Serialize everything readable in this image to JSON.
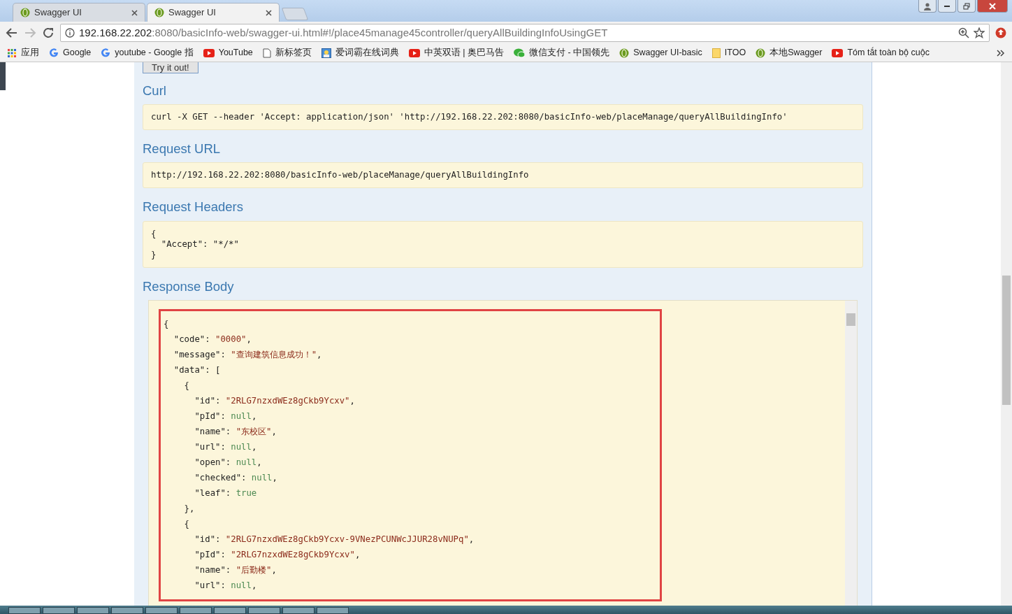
{
  "tabs": [
    {
      "title": "Swagger UI",
      "selected": false
    },
    {
      "title": "Swagger UI",
      "selected": true
    }
  ],
  "address": {
    "host": "192.168.22.202",
    "rest": ":8080/basicInfo-web/swagger-ui.html#!/place45manage45controller/queryAllBuildingInfoUsingGET"
  },
  "bookmarks": [
    {
      "label": "应用",
      "kind": "apps"
    },
    {
      "label": "Google",
      "kind": "google"
    },
    {
      "label": "youtube - Google 指",
      "kind": "google"
    },
    {
      "label": "YouTube",
      "kind": "youtube"
    },
    {
      "label": "新标签页",
      "kind": "page"
    },
    {
      "label": "爱词霸在线词典",
      "kind": "image"
    },
    {
      "label": "中英双语 | 奥巴马告",
      "kind": "youtube"
    },
    {
      "label": "微信支付 - 中国领先",
      "kind": "wechat"
    },
    {
      "label": "Swagger UI-basic",
      "kind": "globe"
    },
    {
      "label": "ITOO",
      "kind": "folder"
    },
    {
      "label": "本地Swagger",
      "kind": "globe"
    },
    {
      "label": "Tóm tắt toàn bộ cuộc",
      "kind": "youtube"
    }
  ],
  "try_button": "Try it out!",
  "sections": [
    {
      "heading": "Curl",
      "lines": [
        "curl -X GET --header 'Accept: application/json' 'http://192.168.22.202:8080/basicInfo-web/placeManage/queryAllBuildingInfo'"
      ]
    },
    {
      "heading": "Request URL",
      "lines": [
        "http://192.168.22.202:8080/basicInfo-web/placeManage/queryAllBuildingInfo"
      ]
    },
    {
      "heading": "Request Headers",
      "lines": [
        "{",
        "  \"Accept\": \"*/*\"",
        "}"
      ]
    }
  ],
  "response": {
    "heading": "Response Body",
    "highlighted": true,
    "lines": [
      [
        {
          "text": "{",
          "kind": "punct"
        }
      ],
      [
        {
          "text": "  \"code\": ",
          "kind": "key"
        },
        {
          "text": "\"0000\"",
          "kind": "string"
        },
        {
          "text": ",",
          "kind": "punct"
        }
      ],
      [
        {
          "text": "  \"message\": ",
          "kind": "key"
        },
        {
          "text": "\"查询建筑信息成功！\"",
          "kind": "string"
        },
        {
          "text": ",",
          "kind": "punct"
        }
      ],
      [
        {
          "text": "  \"data\": [",
          "kind": "key"
        }
      ],
      [
        {
          "text": "    {",
          "kind": "punct"
        }
      ],
      [
        {
          "text": "      \"id\": ",
          "kind": "key"
        },
        {
          "text": "\"2RLG7nzxdWEz8gCkb9Ycxv\"",
          "kind": "string"
        },
        {
          "text": ",",
          "kind": "punct"
        }
      ],
      [
        {
          "text": "      \"pId\": ",
          "kind": "key"
        },
        {
          "text": "null",
          "kind": "literal"
        },
        {
          "text": ",",
          "kind": "punct"
        }
      ],
      [
        {
          "text": "      \"name\": ",
          "kind": "key"
        },
        {
          "text": "\"东校区\"",
          "kind": "string"
        },
        {
          "text": ",",
          "kind": "punct"
        }
      ],
      [
        {
          "text": "      \"url\": ",
          "kind": "key"
        },
        {
          "text": "null",
          "kind": "literal"
        },
        {
          "text": ",",
          "kind": "punct"
        }
      ],
      [
        {
          "text": "      \"open\": ",
          "kind": "key"
        },
        {
          "text": "null",
          "kind": "literal"
        },
        {
          "text": ",",
          "kind": "punct"
        }
      ],
      [
        {
          "text": "      \"checked\": ",
          "kind": "key"
        },
        {
          "text": "null",
          "kind": "literal"
        },
        {
          "text": ",",
          "kind": "punct"
        }
      ],
      [
        {
          "text": "      \"leaf\": ",
          "kind": "key"
        },
        {
          "text": "true",
          "kind": "literal"
        }
      ],
      [
        {
          "text": "    },",
          "kind": "punct"
        }
      ],
      [
        {
          "text": "    {",
          "kind": "punct"
        }
      ],
      [
        {
          "text": "      \"id\": ",
          "kind": "key"
        },
        {
          "text": "\"2RLG7nzxdWEz8gCkb9Ycxv-9VNezPCUNWcJJUR28vNUPq\"",
          "kind": "string"
        },
        {
          "text": ",",
          "kind": "punct"
        }
      ],
      [
        {
          "text": "      \"pId\": ",
          "kind": "key"
        },
        {
          "text": "\"2RLG7nzxdWEz8gCkb9Ycxv\"",
          "kind": "string"
        },
        {
          "text": ",",
          "kind": "punct"
        }
      ],
      [
        {
          "text": "      \"name\": ",
          "kind": "key"
        },
        {
          "text": "\"后勤楼\"",
          "kind": "string"
        },
        {
          "text": ",",
          "kind": "punct"
        }
      ],
      [
        {
          "text": "      \"url\": ",
          "kind": "key"
        },
        {
          "text": "null",
          "kind": "literal"
        },
        {
          "text": ",",
          "kind": "punct"
        }
      ]
    ]
  }
}
